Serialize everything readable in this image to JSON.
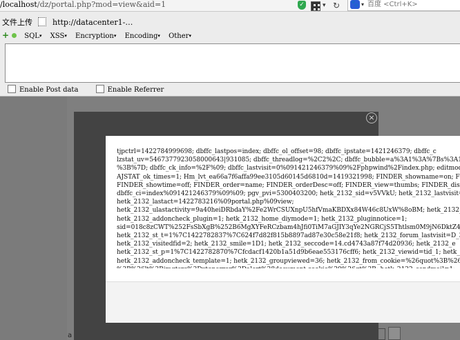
{
  "browser": {
    "url_host": "/localhost",
    "url_path": "/dz/portal.php?mod=view&aid=1",
    "search_hint": "百度 <Ctrl+K>"
  },
  "hackbar": {
    "upload_label": "文件上传",
    "mini_url": "http://datacenter1-…",
    "menus": [
      "SQL",
      "XSS",
      "Encryption",
      "Encoding",
      "Other"
    ],
    "enable_post": "Enable Post data",
    "enable_referrer": "Enable Referrer"
  },
  "dialog": {
    "lines": [
      "tjpctrl=1422784999698; dbffc_lastpos=index; dbffc_ol_offset=98; dbffc_ipstate=1421246379; dbffc_c",
      "lzstat_uv=5467377923058000643|931085; dbffc_threadlog=%2C2%2C; dbffc_bubble=a%3A1%3A%7Bs%3A1%7A%3A%",
      "%3B%7D; dbffc_ck_info=%2F%09; dbffc_lastvisit=0%091421246379%09%2Fphpwind%2Findex.php; editmode=0",
      "AJSTAT_ok_times=1; Hm_lvt_ea66a7f6affa99ee3105d60145d6810d=1419321998; FINDER_showname=on; FINDER",
      "FINDER_showtime=off; FINDER_order=name; FINDER_orderDesc=off; FINDER_view=thumbs; FINDER_displayS",
      "dbffc_ci=index%091421246379%09%09; pgv_pvi=5300403200; hetk_2132_sid=v5VVkU; hetk_2132_lastvisit=",
      "hetk_2132_lastact=1422783216%09portal.php%09view;",
      "hetk_2132_ulastactivity=9a40heiDRbdaY%2Fe2WrCSUXnpU5hfVmaKBDXx84W46c8UxW%8oBM; hetk_2132_checkup",
      "hetk_2132_addoncheck_plugin=1; hetk_2132_home_diymode=1; hetk_2132_pluginnotice=1;",
      "sid=018c8zCWT%252FsSbXgB%252B6MgXYFeRCzbam4hJfi0TiM7aGJIY3qYe2NGRCjS5Thtlsm0M9jN6DktZ4JM%252BA;",
      "hetk_2132_st_t=1%7C1422782837%7C624f7d82f815b8897ad87e30c58e21f8; hetk_2132_forum_lastvisit=D_36_",
      "hetk_2132_visitedfid=2; hetk_2132_smile=1D1; hetk_2132_seccode=14.cd4743a87f74d20936; hetk_2132_e",
      "hetk_2132_st_p=1%7C1422782870%7Cfcdacf1420b1a51d9b6eae553176cff6; hetk_2132_viewid=tid_1; hetk_21",
      "hetk_2132_addoncheck_template=1; hetk_2132_groupviewed=36; hetk_2132_from_cookie=%26quot%3B%26gt",
      "%3B%26lt%3Bimgtsrc%3Dxtonerror%3Dalert%28document.cookie%29%26gt%3B; hetk_2132_sendmail=1;"
    ]
  },
  "background": {
    "footer_letter": "a"
  },
  "colors": {
    "overlay": "#7b7b7b",
    "modal": "#434343",
    "green_accent": "#2e8b1f"
  }
}
